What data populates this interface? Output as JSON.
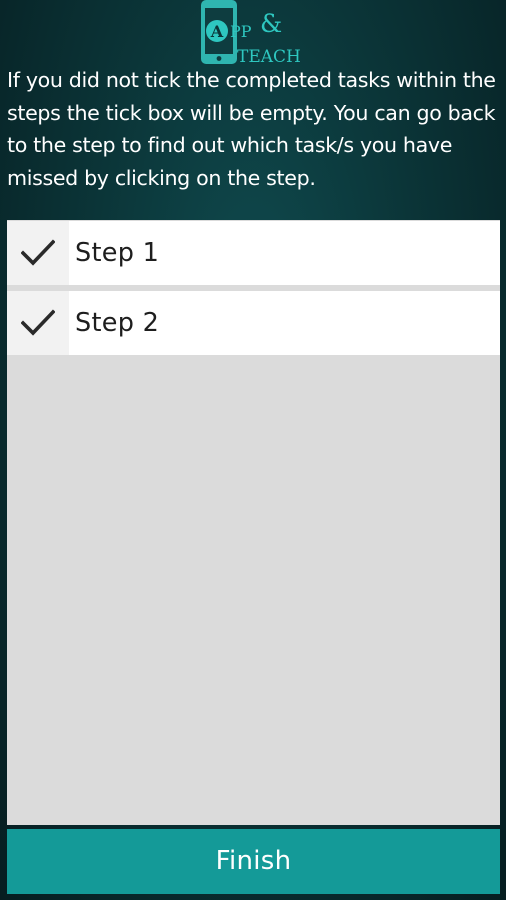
{
  "header": {
    "logo_text": "APP&TEACH",
    "logo_badge_letter": "A",
    "logo_line1": "PP",
    "logo_ampersand": "&",
    "logo_line2": "TEACH"
  },
  "intro": {
    "text": "If you did not tick the completed tasks within the steps the tick box will be empty.  You can go back to the step to find out which task/s you have missed by clicking on the step."
  },
  "steps": [
    {
      "label": "Step 1",
      "checked": true,
      "icon": "checkmark-icon"
    },
    {
      "label": "Step 2",
      "checked": true,
      "icon": "checkmark-icon"
    }
  ],
  "footer": {
    "finish_label": "Finish"
  },
  "colors": {
    "background": "#0b3538",
    "accent": "#149a98",
    "logo_teal": "#2ec7c0",
    "list_background": "#dbdbdb",
    "row_background": "#ffffff"
  }
}
